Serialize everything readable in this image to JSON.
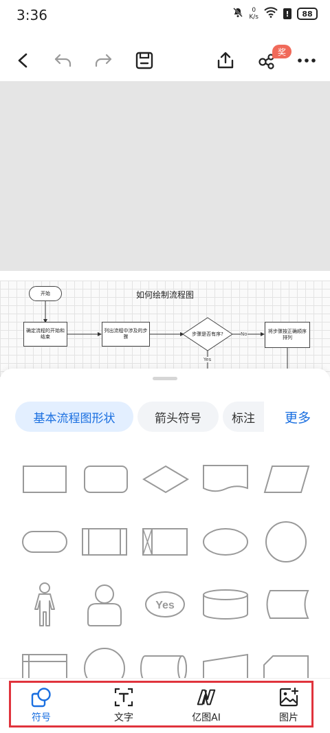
{
  "status_bar": {
    "time": "3:36",
    "net_speed_value": "0",
    "net_speed_unit": "K/s",
    "battery": "88"
  },
  "toolbar": {
    "back_icon": "chevron-left-icon",
    "undo_icon": "undo-icon",
    "redo_icon": "redo-icon",
    "save_icon": "save-icon",
    "share_icon": "share-icon",
    "collab_icon": "share-nodes-icon",
    "award_badge": "奖",
    "more_icon": "more-horizontal-icon"
  },
  "diagram": {
    "title": "如何绘制流程图",
    "start": "开始",
    "node1": "确定流程的开始和结束",
    "node2": "列出流程中涉及的步骤",
    "decision": "步骤是否有序?",
    "node3": "将步骤按正确顺序排列",
    "no_label": "No",
    "yes_label": "Yes"
  },
  "sheet": {
    "categories": [
      {
        "label": "基本流程图形状",
        "active": true
      },
      {
        "label": "箭头符号",
        "active": false
      },
      {
        "label": "标注",
        "active": false
      }
    ],
    "more": "更多",
    "shapes": [
      "process",
      "rounded-process",
      "decision",
      "document",
      "data",
      "terminator",
      "predefined-process",
      "stored-data-box",
      "ellipse",
      "circle",
      "actor",
      "user",
      "yes-bubble",
      "cylinder",
      "stored-data",
      "internal-storage",
      "circle-partial",
      "direct-access",
      "manual-input",
      "card"
    ],
    "yes_text": "Yes"
  },
  "tabbar": {
    "tabs": [
      {
        "label": "符号",
        "icon": "shapes-icon",
        "active": true
      },
      {
        "label": "文字",
        "icon": "text-recognition-icon",
        "active": false
      },
      {
        "label": "亿图AI",
        "icon": "ai-logo-icon",
        "active": false
      },
      {
        "label": "图片",
        "icon": "add-image-icon",
        "active": false
      }
    ]
  },
  "colors": {
    "accent": "#1a6fe0",
    "highlight_outline": "#e0333c",
    "badge": "#f06a5a"
  }
}
